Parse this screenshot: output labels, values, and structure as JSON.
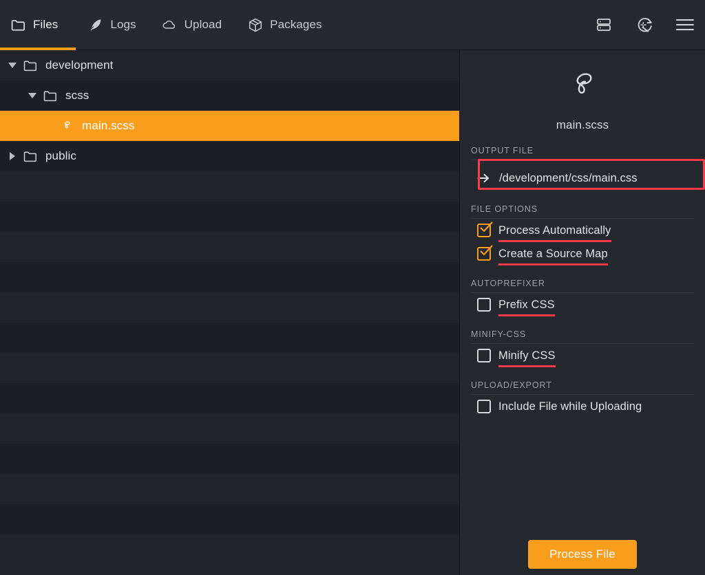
{
  "app": {
    "accent_color": "#f99d1c",
    "annotation_color": "#f93a4a",
    "background_color": "#212429",
    "panel_color": "#25282d"
  },
  "topbar": {
    "tabs": [
      {
        "label": "Files",
        "icon": "folder-icon",
        "active": true
      },
      {
        "label": "Logs",
        "icon": "feather-icon",
        "active": false
      },
      {
        "label": "Upload",
        "icon": "cloud-icon",
        "active": false
      },
      {
        "label": "Packages",
        "icon": "package-icon",
        "active": false
      }
    ],
    "actions": [
      {
        "name": "server-icon"
      },
      {
        "name": "magic-wand-refresh-icon"
      },
      {
        "name": "hamburger-menu-icon"
      }
    ]
  },
  "filetree": {
    "rows": [
      {
        "label": "development",
        "icon": "folder-icon",
        "twisty": "down",
        "level": 0,
        "selected": false
      },
      {
        "label": "scss",
        "icon": "folder-icon",
        "twisty": "down",
        "level": 1,
        "selected": false
      },
      {
        "label": "main.scss",
        "icon": "sass-icon",
        "twisty": "none",
        "level": 2,
        "selected": true
      },
      {
        "label": "public",
        "icon": "folder-icon",
        "twisty": "right",
        "level": 0,
        "selected": false
      }
    ],
    "empty_row_count": 13
  },
  "panel": {
    "file": {
      "icon": "sass-icon",
      "name": "main.scss"
    },
    "output": {
      "section_label": "OUTPUT FILE",
      "arrow_icon": "arrow-right-icon",
      "path": "/development/css/main.css",
      "annotated": true
    },
    "sections": [
      {
        "label": "FILE OPTIONS",
        "options": [
          {
            "label": "Process Automatically",
            "checked": true,
            "annotated": true
          },
          {
            "label": "Create a Source Map",
            "checked": true,
            "annotated": true
          }
        ]
      },
      {
        "label": "AUTOPREFIXER",
        "options": [
          {
            "label": "Prefix CSS",
            "checked": false,
            "annotated": true
          }
        ]
      },
      {
        "label": "MINIFY-CSS",
        "options": [
          {
            "label": "Minify CSS",
            "checked": false,
            "annotated": true
          }
        ]
      },
      {
        "label": "UPLOAD/EXPORT",
        "options": [
          {
            "label": "Include File while Uploading",
            "checked": false,
            "annotated": false
          }
        ]
      }
    ],
    "process_button": "Process File"
  }
}
